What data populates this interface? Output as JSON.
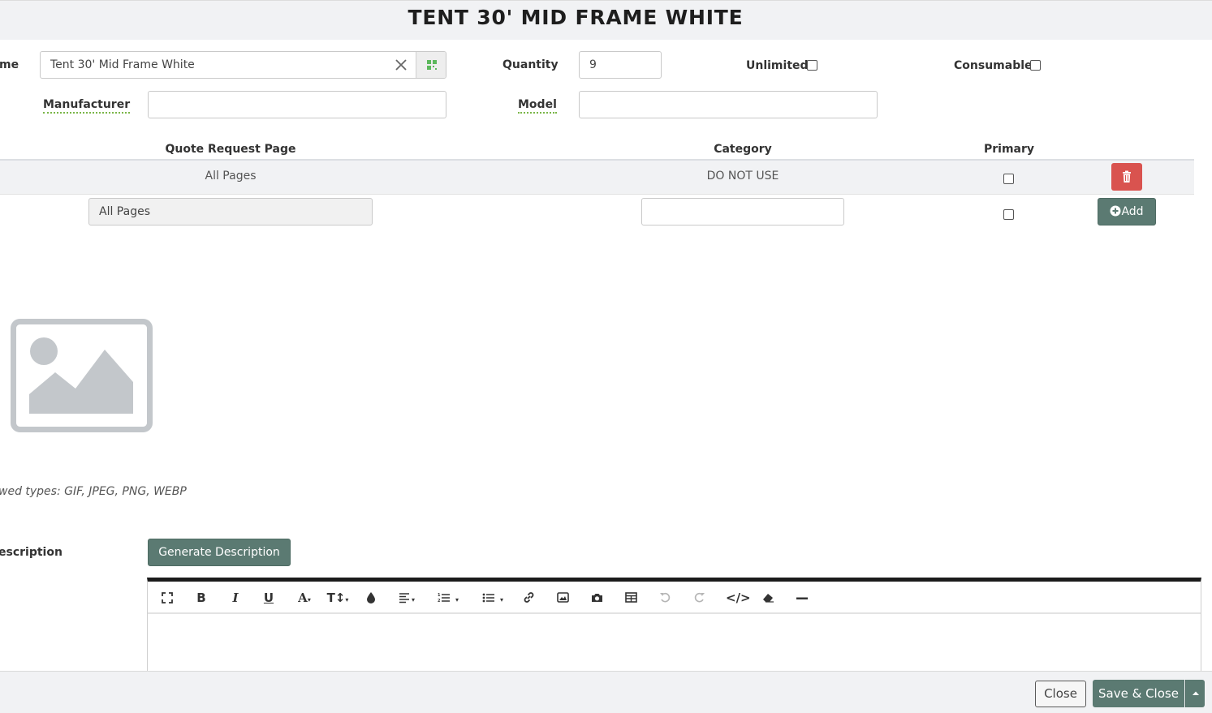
{
  "modal": {
    "title": "TENT 30' MID FRAME WHITE"
  },
  "form": {
    "name_label_visible": "me",
    "name_value": "Tent 30' Mid Frame White",
    "quantity_label": "Quantity",
    "quantity_value": "9",
    "unlimited_label": "Unlimited",
    "consumable_label": "Consumable",
    "manufacturer_label": "Manufacturer",
    "manufacturer_value": "",
    "model_label": "Model",
    "model_value": ""
  },
  "category_table": {
    "headers": [
      "Quote Request Page",
      "Category",
      "Primary"
    ],
    "rows": [
      {
        "quote_request_page": "All Pages",
        "category": "DO NOT USE",
        "primary": false
      }
    ],
    "new_row": {
      "quote_request_page_value": "All Pages",
      "category_value": "",
      "add_label": "Add"
    }
  },
  "image": {
    "allowed_types_visible": "wed types: GIF, JPEG, PNG, WEBP"
  },
  "description": {
    "label_visible": "escription",
    "generate_label": "Generate Description"
  },
  "toolbar": {
    "buttons": [
      "fullscreen-icon",
      "bold-icon",
      "italic-icon",
      "underline-icon",
      "font-color-icon",
      "font-size-icon",
      "color-drop-icon",
      "align-icon",
      "ordered-list-icon",
      "unordered-list-icon",
      "link-icon",
      "image-icon",
      "camera-icon",
      "table-icon",
      "undo-icon",
      "redo-icon",
      "code-view-icon",
      "eraser-icon",
      "horizontal-rule-icon"
    ]
  },
  "footer": {
    "close_label": "Close",
    "save_close_label": "Save & Close"
  },
  "colors": {
    "primary_green": "#5b7a72",
    "danger_red": "#d9534f",
    "header_bg": "#f1f2f4"
  }
}
